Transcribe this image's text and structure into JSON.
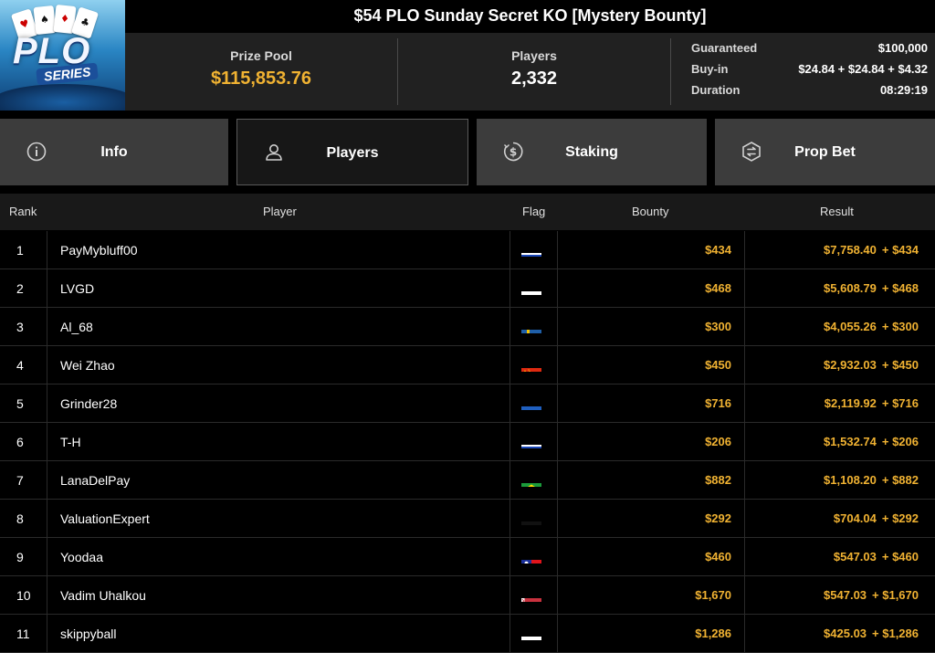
{
  "title": "$54 PLO Sunday Secret KO [Mystery Bounty]",
  "logo": {
    "main": "PLO",
    "sub": "SERIES"
  },
  "stats": {
    "prize_pool_label": "Prize Pool",
    "prize_pool_value": "$115,853.76",
    "players_label": "Players",
    "players_value": "2,332"
  },
  "details": {
    "guaranteed_label": "Guaranteed",
    "guaranteed_value": "$100,000",
    "buyin_label": "Buy-in",
    "buyin_value": "$24.84 + $24.84 + $4.32",
    "duration_label": "Duration",
    "duration_value": "08:29:19"
  },
  "tabs": [
    {
      "label": "Info",
      "icon": "info-icon"
    },
    {
      "label": "Players",
      "icon": "user-icon"
    },
    {
      "label": "Staking",
      "icon": "dollar-coin-icon"
    },
    {
      "label": "Prop Bet",
      "icon": "prop-bet-icon"
    }
  ],
  "table": {
    "headers": {
      "rank": "Rank",
      "player": "Player",
      "flag": "Flag",
      "bounty": "Bounty",
      "result": "Result"
    },
    "rows": [
      {
        "rank": "1",
        "player": "PayMybluff00",
        "flag": "israel",
        "bounty": "$434",
        "result": "$7,758.40",
        "result_bounty": "+ $434"
      },
      {
        "rank": "2",
        "player": "LVGD",
        "flag": "russia",
        "bounty": "$468",
        "result": "$5,608.79",
        "result_bounty": "+ $468"
      },
      {
        "rank": "3",
        "player": "Al_68",
        "flag": "sweden",
        "bounty": "$300",
        "result": "$4,055.26",
        "result_bounty": "+ $300"
      },
      {
        "rank": "4",
        "player": "Wei Zhao",
        "flag": "china",
        "bounty": "$450",
        "result": "$2,932.03",
        "result_bounty": "+ $450"
      },
      {
        "rank": "5",
        "player": "Grinder28",
        "flag": "ukraine",
        "bounty": "$716",
        "result": "$2,119.92",
        "result_bounty": "+ $716"
      },
      {
        "rank": "6",
        "player": "T-H",
        "flag": "israel",
        "bounty": "$206",
        "result": "$1,532.74",
        "result_bounty": "+ $206"
      },
      {
        "rank": "7",
        "player": "LanaDelPay",
        "flag": "brazil",
        "bounty": "$882",
        "result": "$1,108.20",
        "result_bounty": "+ $882"
      },
      {
        "rank": "8",
        "player": "ValuationExpert",
        "flag": "germany",
        "bounty": "$292",
        "result": "$704.04",
        "result_bounty": "+ $292"
      },
      {
        "rank": "9",
        "player": "Yoodaa",
        "flag": "taiwan",
        "bounty": "$460",
        "result": "$547.03",
        "result_bounty": "+ $460"
      },
      {
        "rank": "10",
        "player": "Vadim Uhalkou",
        "flag": "belarus",
        "bounty": "$1,670",
        "result": "$547.03",
        "result_bounty": "+ $1,670"
      },
      {
        "rank": "11",
        "player": "skippyball",
        "flag": "poland",
        "bounty": "$1,286",
        "result": "$425.03",
        "result_bounty": "+ $1,286"
      }
    ]
  },
  "colors": {
    "accent": "#f0b232",
    "tab_bg": "#3c3c3c",
    "header_bg": "#212121"
  }
}
